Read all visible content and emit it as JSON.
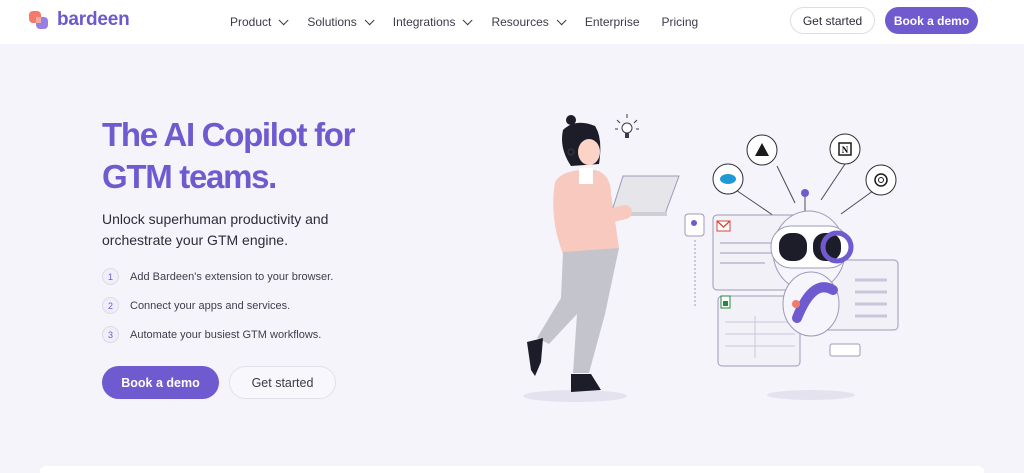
{
  "brand": {
    "name": "bardeen",
    "color": "#6f5bcf"
  },
  "nav": {
    "items": [
      {
        "label": "Product",
        "has_dropdown": true
      },
      {
        "label": "Solutions",
        "has_dropdown": true
      },
      {
        "label": "Integrations",
        "has_dropdown": true
      },
      {
        "label": "Resources",
        "has_dropdown": true
      },
      {
        "label": "Enterprise",
        "has_dropdown": false
      },
      {
        "label": "Pricing",
        "has_dropdown": false
      }
    ],
    "get_started": "Get started",
    "book_demo": "Book a demo"
  },
  "hero": {
    "title_line1": "The AI Copilot for",
    "title_line2": "GTM teams.",
    "subtitle_line1": "Unlock superhuman productivity and",
    "subtitle_line2": "orchestrate your GTM engine.",
    "steps": [
      {
        "num": "1",
        "text": "Add Bardeen's extension to your browser."
      },
      {
        "num": "2",
        "text": "Connect your apps and services."
      },
      {
        "num": "3",
        "text": "Automate your busiest GTM workflows."
      }
    ],
    "cta_primary": "Book a demo",
    "cta_secondary": "Get started"
  },
  "illustration": {
    "icons": [
      "salesforce-icon",
      "arrow-app-icon",
      "notion-icon",
      "openai-icon",
      "gmail-icon",
      "linkedin-icon",
      "sheets-icon"
    ]
  }
}
